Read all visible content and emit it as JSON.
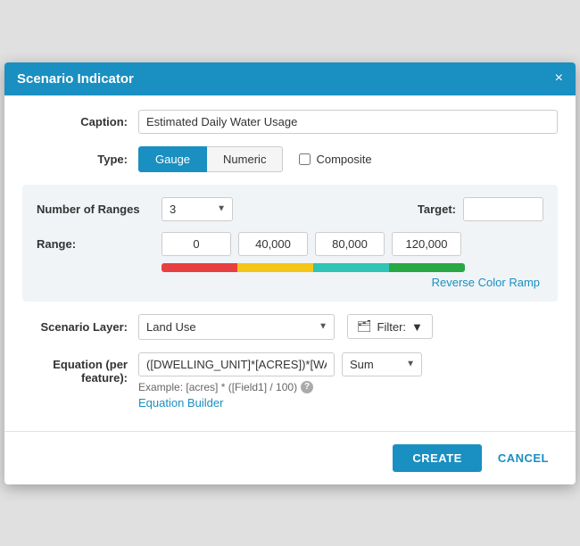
{
  "dialog": {
    "title": "Scenario Indicator",
    "close_label": "×"
  },
  "caption": {
    "label": "Caption:",
    "value": "Estimated Daily Water Usage"
  },
  "type": {
    "label": "Type:",
    "gauge_label": "Gauge",
    "numeric_label": "Numeric",
    "composite_label": "Composite"
  },
  "ranges": {
    "number_label": "Number of Ranges",
    "value": "3",
    "target_label": "Target:",
    "target_value": "",
    "range_label": "Range:",
    "range_values": [
      "0",
      "40,000",
      "80,000",
      "120,000"
    ],
    "reverse_link": "Reverse Color Ramp"
  },
  "scenario": {
    "label": "Scenario Layer:",
    "value": "Land Use",
    "filter_label": "Filter:",
    "filter_icon": "▼"
  },
  "equation": {
    "label": "Equation (per feature):",
    "value": "([DWELLING_UNIT]*[ACRES])*[WATE",
    "sum_label": "Sum",
    "example_text": "Example: [acres] * ([Field1] / 100)",
    "builder_link": "Equation Builder"
  },
  "footer": {
    "create_label": "CREATE",
    "cancel_label": "CANCEL"
  },
  "colors": {
    "header_bg": "#1a8fc1",
    "active_btn": "#1a8fc1",
    "link": "#1a8fc1"
  }
}
